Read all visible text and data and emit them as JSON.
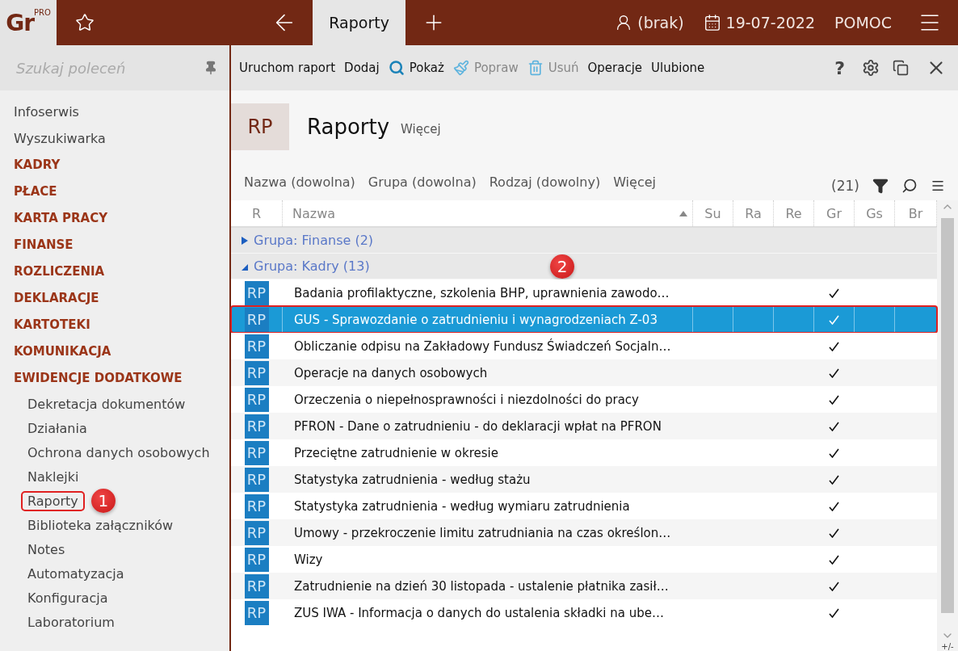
{
  "logo": {
    "text": "Gr",
    "sup": "PRO"
  },
  "topbar": {
    "tab": {
      "label": "Raporty",
      "selected": true
    },
    "user": "(brak)",
    "date": "19-07-2022",
    "help": "POMOC"
  },
  "sidebar": {
    "search": {
      "placeholder": "Szukaj poleceń"
    },
    "items": [
      {
        "label": "Infoserwis",
        "kind": "link"
      },
      {
        "label": "Wyszukiwarka",
        "kind": "link"
      },
      {
        "label": "KADRY",
        "kind": "section"
      },
      {
        "label": "PŁACE",
        "kind": "section"
      },
      {
        "label": "KARTA PRACY",
        "kind": "section"
      },
      {
        "label": "FINANSE",
        "kind": "section"
      },
      {
        "label": "ROZLICZENIA",
        "kind": "section"
      },
      {
        "label": "DEKLARACJE",
        "kind": "section"
      },
      {
        "label": "KARTOTEKI",
        "kind": "section"
      },
      {
        "label": "KOMUNIKACJA",
        "kind": "section"
      },
      {
        "label": "EWIDENCJE DODATKOWE",
        "kind": "section",
        "children": [
          {
            "label": "Dekretacja dokumentów",
            "highlighted": false
          },
          {
            "label": "Działania",
            "highlighted": false
          },
          {
            "label": "Ochrona danych osobowych",
            "highlighted": false
          },
          {
            "label": "Naklejki",
            "highlighted": false
          },
          {
            "label": "Raporty",
            "highlighted": true,
            "badge": "1"
          },
          {
            "label": "Biblioteka załączników",
            "highlighted": false
          },
          {
            "label": "Notes",
            "highlighted": false
          },
          {
            "label": "Automatyzacja",
            "highlighted": false
          },
          {
            "label": "Konfiguracja",
            "highlighted": false
          },
          {
            "label": "Laboratorium",
            "highlighted": false
          }
        ]
      }
    ]
  },
  "toolbar": {
    "items": [
      {
        "label": "Uruchom raport",
        "kind": "plain",
        "disabled": false
      },
      {
        "label": "Dodaj",
        "kind": "plain",
        "disabled": false
      },
      {
        "label": "Pokaż",
        "kind": "search",
        "disabled": false
      },
      {
        "label": "Popraw",
        "kind": "edit",
        "disabled": true
      },
      {
        "label": "Usuń",
        "kind": "delete",
        "disabled": true
      },
      {
        "label": "Operacje",
        "kind": "plain",
        "disabled": false
      },
      {
        "label": "Ulubione",
        "kind": "plain",
        "disabled": false
      }
    ],
    "help": "?"
  },
  "header": {
    "tile": "RP",
    "title": "Raporty",
    "more": "Więcej"
  },
  "filters": {
    "items": [
      "Nazwa (dowolna)",
      "Grupa (dowolna)",
      "Rodzaj (dowolny)",
      "Więcej"
    ],
    "count": "(21)"
  },
  "table": {
    "columns": [
      "R",
      "Nazwa",
      "Su",
      "Ra",
      "Re",
      "Gr",
      "Gs",
      "Br"
    ],
    "groups": [
      {
        "label": "Grupa: Finanse (2)",
        "expanded": false
      },
      {
        "label": "Grupa: Kadry (13)",
        "expanded": true,
        "badge": "2"
      }
    ],
    "rows": [
      {
        "icon": "RP",
        "name": "Badania profilaktyczne, szkolenia BHP, uprawnienia zawodo…",
        "flags": [
          false,
          false,
          false,
          true,
          false,
          false
        ],
        "selected": false
      },
      {
        "icon": "RP",
        "name": "GUS - Sprawozdanie o zatrudnieniu i wynagrodzeniach Z-03",
        "flags": [
          false,
          false,
          false,
          true,
          false,
          false
        ],
        "selected": true
      },
      {
        "icon": "RP",
        "name": "Obliczanie odpisu na Zakładowy Fundusz Świadczeń Socjaln…",
        "flags": [
          false,
          false,
          false,
          true,
          false,
          false
        ],
        "selected": false
      },
      {
        "icon": "RP",
        "name": "Operacje na danych osobowych",
        "flags": [
          false,
          false,
          false,
          true,
          false,
          false
        ],
        "selected": false
      },
      {
        "icon": "RP",
        "name": "Orzeczenia o niepełnosprawności i niezdolności do pracy",
        "flags": [
          false,
          false,
          false,
          true,
          false,
          false
        ],
        "selected": false
      },
      {
        "icon": "RP",
        "name": "PFRON - Dane o zatrudnieniu - do deklaracji wpłat na PFRON",
        "flags": [
          false,
          false,
          false,
          true,
          false,
          false
        ],
        "selected": false
      },
      {
        "icon": "RP",
        "name": "Przeciętne zatrudnienie w okresie",
        "flags": [
          false,
          false,
          false,
          true,
          false,
          false
        ],
        "selected": false
      },
      {
        "icon": "RP",
        "name": "Statystyka zatrudnienia - według stażu",
        "flags": [
          false,
          false,
          false,
          true,
          false,
          false
        ],
        "selected": false
      },
      {
        "icon": "RP",
        "name": "Statystyka zatrudnienia - według wymiaru zatrudnienia",
        "flags": [
          false,
          false,
          false,
          true,
          false,
          false
        ],
        "selected": false
      },
      {
        "icon": "RP",
        "name": "Umowy - przekroczenie limitu zatrudniania na czas określon…",
        "flags": [
          false,
          false,
          false,
          true,
          false,
          false
        ],
        "selected": false
      },
      {
        "icon": "RP",
        "name": "Wizy",
        "flags": [
          false,
          false,
          false,
          true,
          false,
          false
        ],
        "selected": false
      },
      {
        "icon": "RP",
        "name": "Zatrudnienie na dzień 30 listopada - ustalenie płatnika zasił…",
        "flags": [
          false,
          false,
          false,
          true,
          false,
          false
        ],
        "selected": false
      },
      {
        "icon": "RP",
        "name": "ZUS IWA - Informacja o danych do ustalenia składki na ube…",
        "flags": [
          false,
          false,
          false,
          true,
          false,
          false
        ],
        "selected": false
      }
    ],
    "corner": "+/-"
  }
}
